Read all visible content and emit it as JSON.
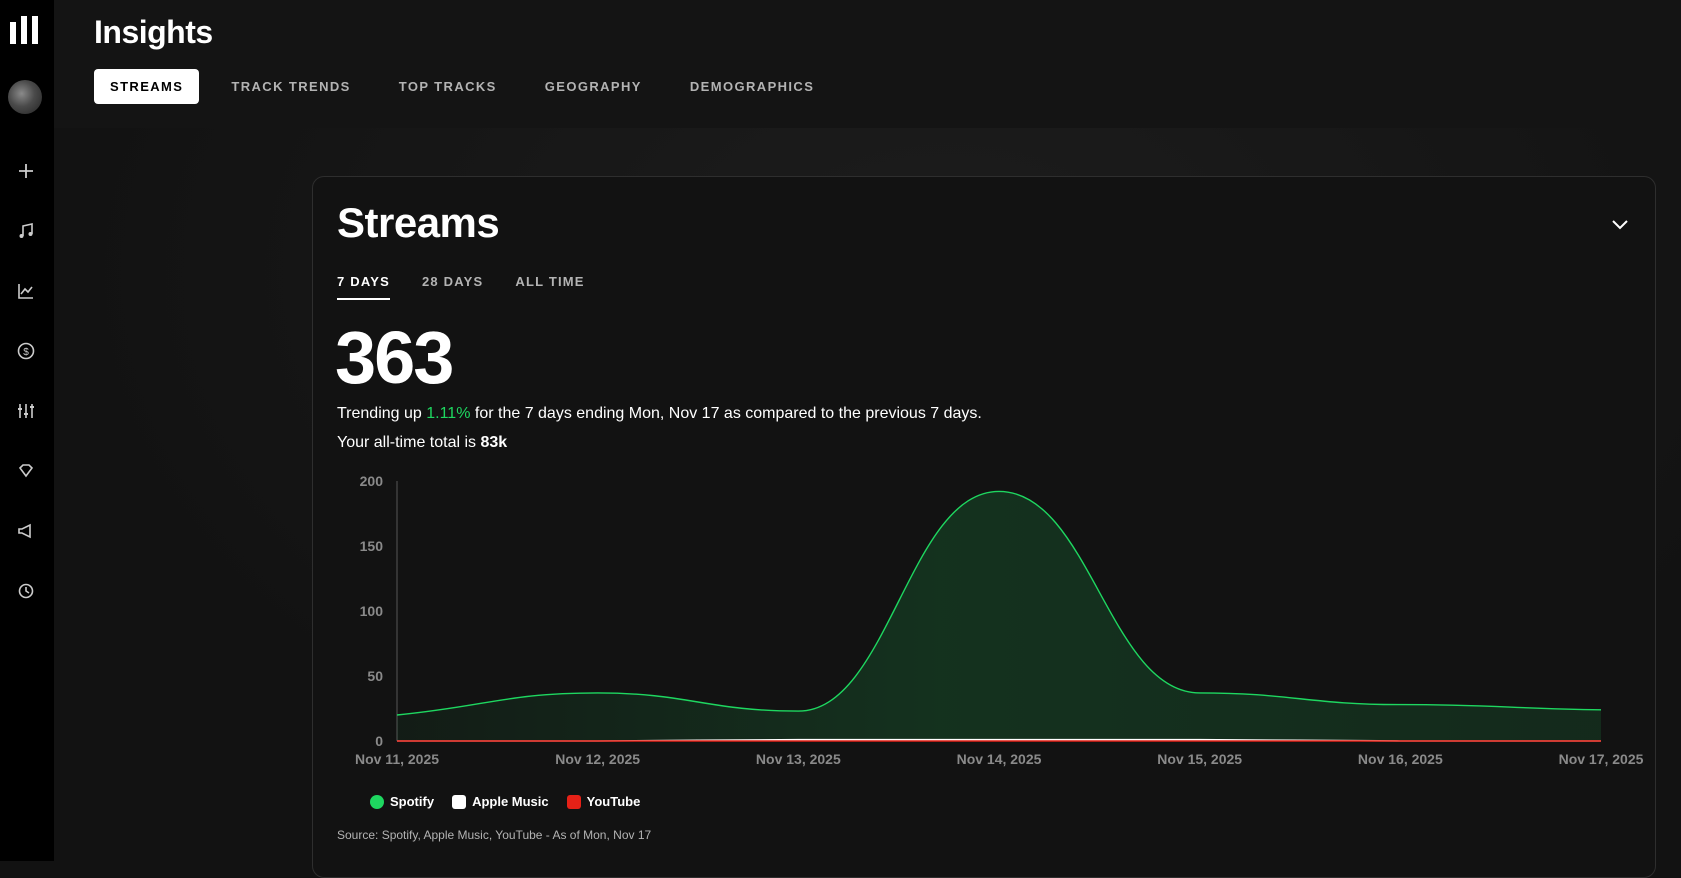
{
  "sidebar": {
    "icons": [
      "logo-icon",
      "avatar",
      "plus-icon",
      "music-note-icon",
      "chart-icon",
      "dollar-icon",
      "sliders-icon",
      "diamond-icon",
      "megaphone-icon",
      "history-icon"
    ]
  },
  "header": {
    "title": "Insights",
    "tabs": [
      "STREAMS",
      "TRACK TRENDS",
      "TOP TRACKS",
      "GEOGRAPHY",
      "DEMOGRAPHICS"
    ],
    "active_tab": "STREAMS"
  },
  "card": {
    "title": "Streams",
    "range_tabs": [
      "7 DAYS",
      "28 DAYS",
      "ALL TIME"
    ],
    "active_range": "7 DAYS",
    "stream_count": "363",
    "trend_prefix": "Trending up ",
    "trend_pct": "1.11%",
    "trend_suffix": " for the 7 days ending Mon, Nov 17 as compared to the previous 7 days.",
    "total_prefix": "Your all-time total is ",
    "total_value": "83k",
    "source": "Source: Spotify, Apple Music, YouTube - As of Mon, Nov 17"
  },
  "colors": {
    "spotify": "#1ed760",
    "apple_music": "#ffffff",
    "youtube": "#e62117",
    "muted": "#b3b3b3"
  },
  "chart_data": {
    "type": "area",
    "x": [
      "Nov 11, 2025",
      "Nov 12, 2025",
      "Nov 13, 2025",
      "Nov 14, 2025",
      "Nov 15, 2025",
      "Nov 16, 2025",
      "Nov 17, 2025"
    ],
    "ylim": [
      0,
      200
    ],
    "yticks": [
      0,
      50,
      100,
      150,
      200
    ],
    "series": [
      {
        "name": "Spotify",
        "values": [
          20,
          37,
          23,
          192,
          37,
          28,
          24
        ],
        "color": "#1ed760"
      },
      {
        "name": "Apple Music",
        "values": [
          0,
          0,
          1,
          1,
          1,
          0,
          0
        ],
        "color": "#ffffff"
      },
      {
        "name": "YouTube",
        "values": [
          0,
          0,
          0,
          0,
          0,
          0,
          0
        ],
        "color": "#e62117"
      }
    ],
    "legend": "bottom-left",
    "grid": false
  }
}
